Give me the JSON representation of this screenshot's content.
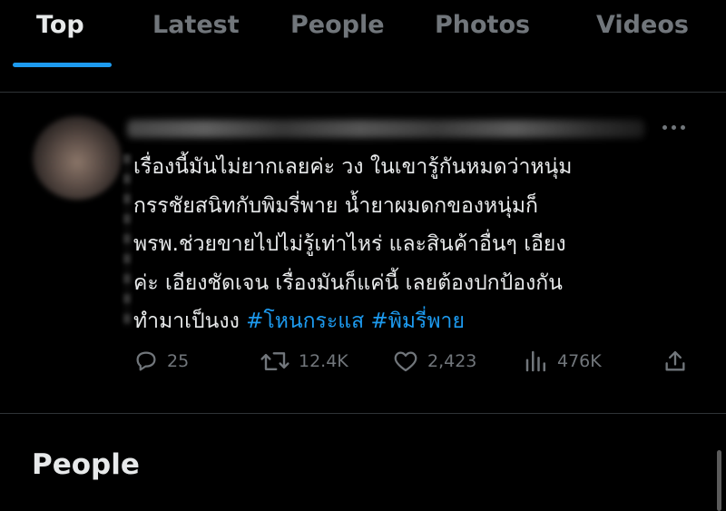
{
  "tabs": [
    {
      "label": "Top",
      "active": true
    },
    {
      "label": "Latest",
      "active": false
    },
    {
      "label": "People",
      "active": false
    },
    {
      "label": "Photos",
      "active": false
    },
    {
      "label": "Videos",
      "active": false
    }
  ],
  "tweet": {
    "text_lines": [
      "เรื่องนี้มันไม่ยากเลยค่ะ วง ในเขารู้กันหมดว่าหนุ่ม",
      "กรรชัยสนิทกับพิมรี่พาย น้ำยาผมดกของหนุ่มก็",
      "พรพ.ช่วยขายไปไม่รู้เท่าไหร่ และสินค้าอื่นๆ เอียง",
      "ค่ะ เอียงชัดเจน เรื่องมันก็แค่นี้ เลยต้องปกป้องกัน"
    ],
    "last_line_text": "ทำมาเป็นงง",
    "hashtags": [
      "#โหนกระแส",
      "#พิมรี่พาย"
    ],
    "replies": "25",
    "retweets": "12.4K",
    "likes": "2,423",
    "views": "476K"
  },
  "section_heading": "People",
  "colors": {
    "accent": "#1d9bf0",
    "muted": "#71767b",
    "text": "#e7e9ea",
    "background": "#000000"
  }
}
